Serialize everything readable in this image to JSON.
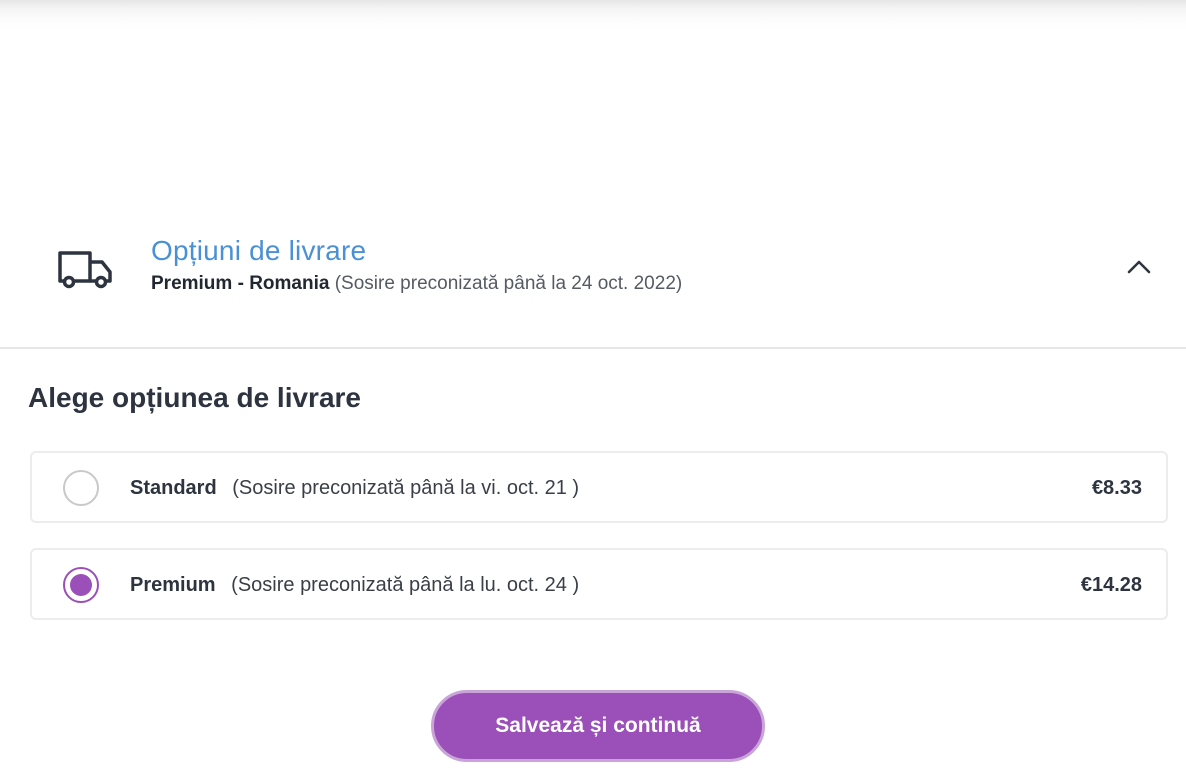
{
  "delivery": {
    "title": "Opțiuni de livrare",
    "selected_method": "Premium - Romania",
    "selected_estimate": "(Sosire preconizată până la 24 oct. 2022)",
    "truck_icon": "truck-icon",
    "collapse_icon": "chevron-up-icon"
  },
  "section": {
    "title": "Alege opțiunea de livrare"
  },
  "options": [
    {
      "name": "Standard",
      "estimate": "(Sosire preconizată până la vi. oct. 21 )",
      "price": "€8.33",
      "selected": false
    },
    {
      "name": "Premium",
      "estimate": "(Sosire preconizată până la lu. oct. 24 )",
      "price": "€14.28",
      "selected": true
    }
  ],
  "actions": {
    "save_label": "Salvează și continuă"
  },
  "colors": {
    "accent": "#9b4fb8",
    "title_blue": "#4a90d6",
    "text_dark": "#2d3440"
  }
}
